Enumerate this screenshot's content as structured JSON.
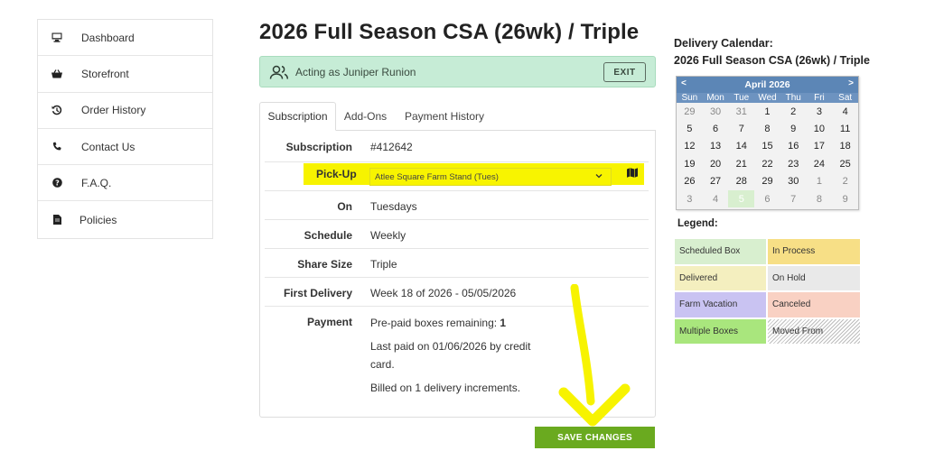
{
  "sidebar": {
    "items": [
      {
        "label": "Dashboard",
        "icon": "monitor-icon"
      },
      {
        "label": "Storefront",
        "icon": "basket-icon"
      },
      {
        "label": "Order History",
        "icon": "history-icon"
      },
      {
        "label": "Contact Us",
        "icon": "phone-icon"
      },
      {
        "label": "F.A.Q.",
        "icon": "question-icon"
      },
      {
        "label": "Policies",
        "icon": "document-icon"
      }
    ]
  },
  "page_title": "2026 Full Season CSA (26wk) / Triple",
  "acting": {
    "text": "Acting as Juniper Runion",
    "exit_label": "EXIT"
  },
  "tabs": [
    {
      "label": "Subscription",
      "active": true
    },
    {
      "label": "Add-Ons",
      "active": false
    },
    {
      "label": "Payment History",
      "active": false
    }
  ],
  "details": {
    "subscription": {
      "label": "Subscription",
      "value": "#412642"
    },
    "pickup": {
      "label": "Pick-Up",
      "value": "Atlee Square Farm Stand (Tues)"
    },
    "on": {
      "label": "On",
      "value": "Tuesdays"
    },
    "schedule": {
      "label": "Schedule",
      "value": "Weekly"
    },
    "share_size": {
      "label": "Share Size",
      "value": "Triple"
    },
    "first_delivery": {
      "label": "First Delivery",
      "value": "Week 18 of 2026 - 05/05/2026"
    },
    "payment": {
      "label": "Payment",
      "prepaid_label": "Pre-paid boxes remaining: ",
      "prepaid_count": "1",
      "last_paid_line1": "Last paid on 01/06/2026 by credit",
      "last_paid_line2": "card.",
      "billed": "Billed on 1 delivery increments."
    }
  },
  "save_label": "SAVE CHANGES",
  "calendar": {
    "title_line1": "Delivery Calendar:",
    "title_line2": "2026 Full Season CSA (26wk) / Triple",
    "month": "April 2026",
    "prev": "<",
    "next": ">",
    "dow": [
      "Sun",
      "Mon",
      "Tue",
      "Wed",
      "Thu",
      "Fri",
      "Sat"
    ],
    "days": [
      {
        "d": "29",
        "other": true
      },
      {
        "d": "30",
        "other": true
      },
      {
        "d": "31",
        "other": true
      },
      {
        "d": "1"
      },
      {
        "d": "2"
      },
      {
        "d": "3"
      },
      {
        "d": "4"
      },
      {
        "d": "5"
      },
      {
        "d": "6"
      },
      {
        "d": "7"
      },
      {
        "d": "8"
      },
      {
        "d": "9"
      },
      {
        "d": "10"
      },
      {
        "d": "11"
      },
      {
        "d": "12"
      },
      {
        "d": "13"
      },
      {
        "d": "14"
      },
      {
        "d": "15"
      },
      {
        "d": "16"
      },
      {
        "d": "17"
      },
      {
        "d": "18"
      },
      {
        "d": "19"
      },
      {
        "d": "20"
      },
      {
        "d": "21"
      },
      {
        "d": "22"
      },
      {
        "d": "23"
      },
      {
        "d": "24"
      },
      {
        "d": "25"
      },
      {
        "d": "26"
      },
      {
        "d": "27"
      },
      {
        "d": "28"
      },
      {
        "d": "29"
      },
      {
        "d": "30"
      },
      {
        "d": "1",
        "other": true
      },
      {
        "d": "2",
        "other": true
      },
      {
        "d": "3",
        "other": true
      },
      {
        "d": "4",
        "other": true
      },
      {
        "d": "5",
        "other": true,
        "scheduled": true
      },
      {
        "d": "6",
        "other": true
      },
      {
        "d": "7",
        "other": true
      },
      {
        "d": "8",
        "other": true
      },
      {
        "d": "9",
        "other": true
      }
    ]
  },
  "legend": {
    "title": "Legend:",
    "items": [
      {
        "label": "Scheduled Box",
        "color": "#d8efcf"
      },
      {
        "label": "In Process",
        "color": "#f7df86"
      },
      {
        "label": "Delivered",
        "color": "#f4efbf"
      },
      {
        "label": "On Hold",
        "color": "#e9e9e9"
      },
      {
        "label": "Farm Vacation",
        "color": "#c9c3f2"
      },
      {
        "label": "Canceled",
        "color": "#f9d1c3"
      },
      {
        "label": "Multiple Boxes",
        "color": "#a9e67d"
      },
      {
        "label": "Moved From",
        "color": "hatched"
      }
    ]
  },
  "colors": {
    "accent_green": "#6aaa1f",
    "highlight_yellow": "#f7f300",
    "calendar_blue": "#5c86b6"
  }
}
